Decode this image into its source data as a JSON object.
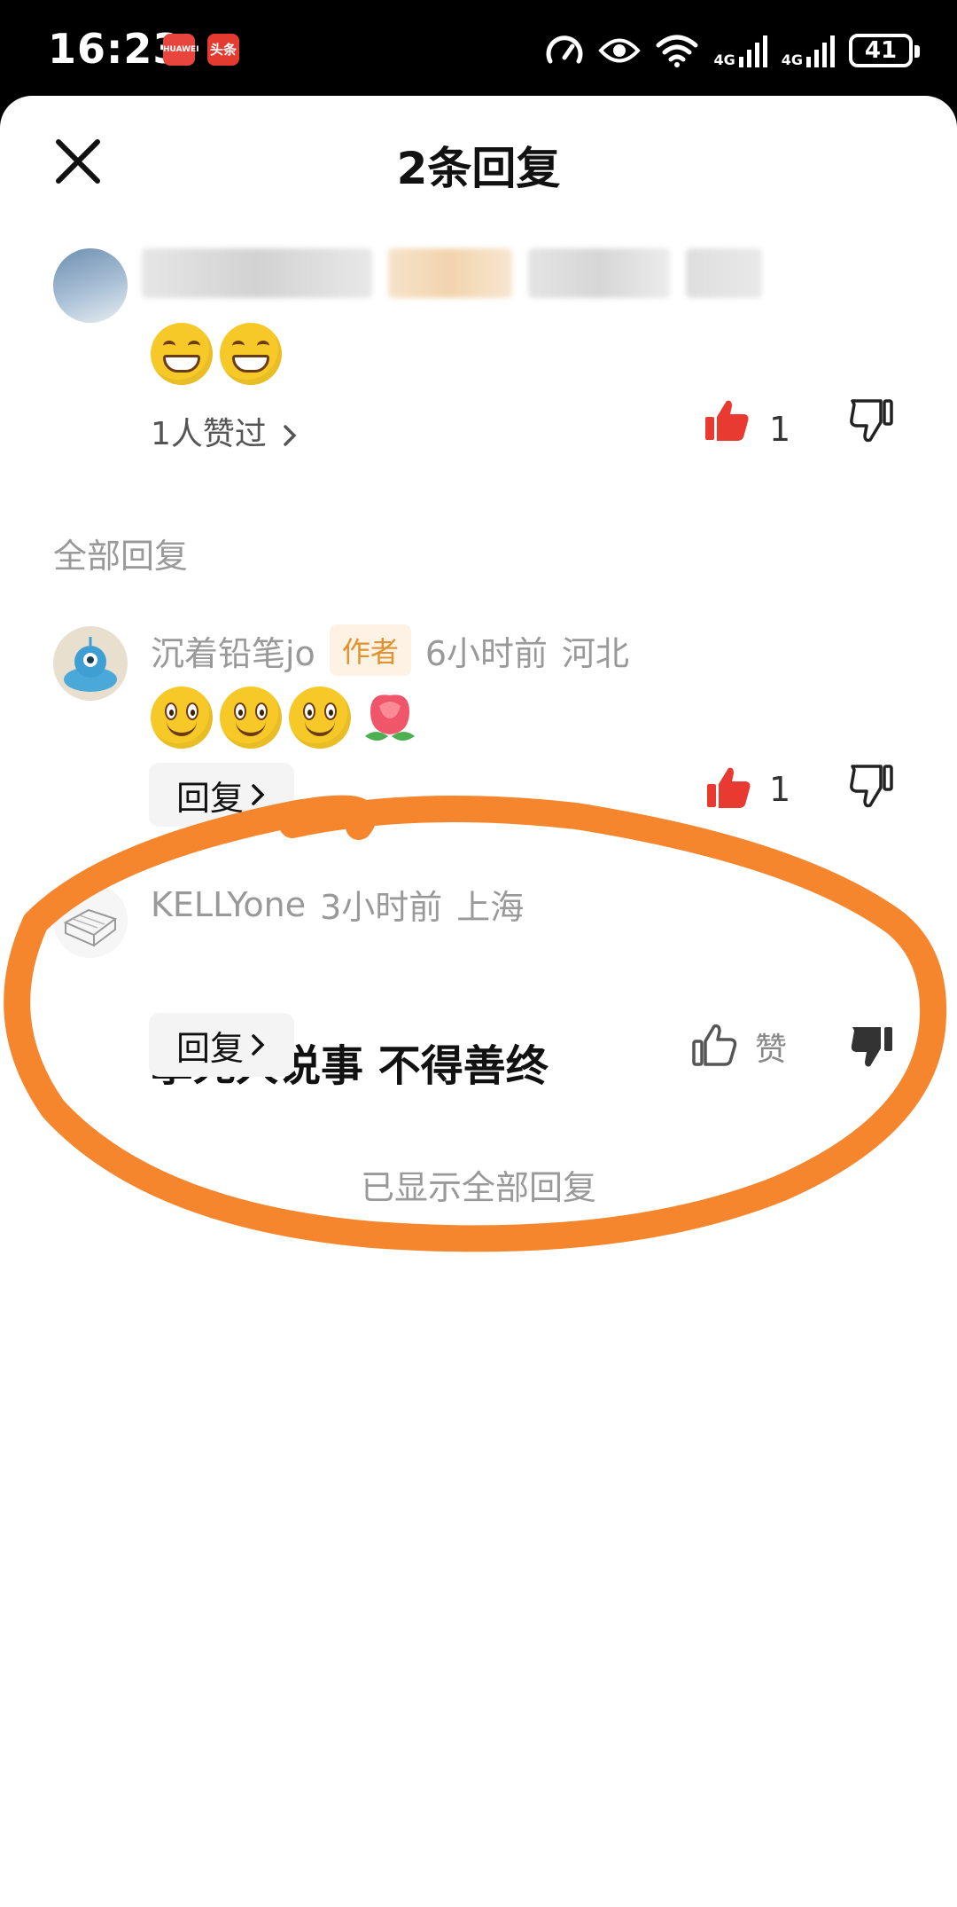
{
  "status_bar": {
    "time": "16:23",
    "app_badges": [
      "HUAWEI",
      "头条"
    ],
    "network": [
      "4G",
      "4G"
    ],
    "battery": "41"
  },
  "header": {
    "title": "2条回复"
  },
  "parent_comment": {
    "emoji": [
      "grin",
      "grin"
    ],
    "likes_link": "1人赞过",
    "like_count": "1"
  },
  "section_label": "全部回复",
  "replies": [
    {
      "username": "沉着铅笔jo",
      "tag": "作者",
      "time": "6小时前",
      "location": "河北",
      "emoji": [
        "smile",
        "smile",
        "smile",
        "rose"
      ],
      "reply_label": "回复",
      "like_count": "1"
    },
    {
      "username": "KELLYone",
      "time": "3小时前",
      "location": "上海",
      "text": "拿死人说事 不得善终",
      "reply_label": "回复",
      "like_label": "赞"
    }
  ],
  "footer_text": "已显示全部回复",
  "colors": {
    "like_active": "#e83a30",
    "author_tag_bg": "#fdf2e3",
    "author_tag_fg": "#e0922e",
    "annotation": "#f5862e"
  }
}
